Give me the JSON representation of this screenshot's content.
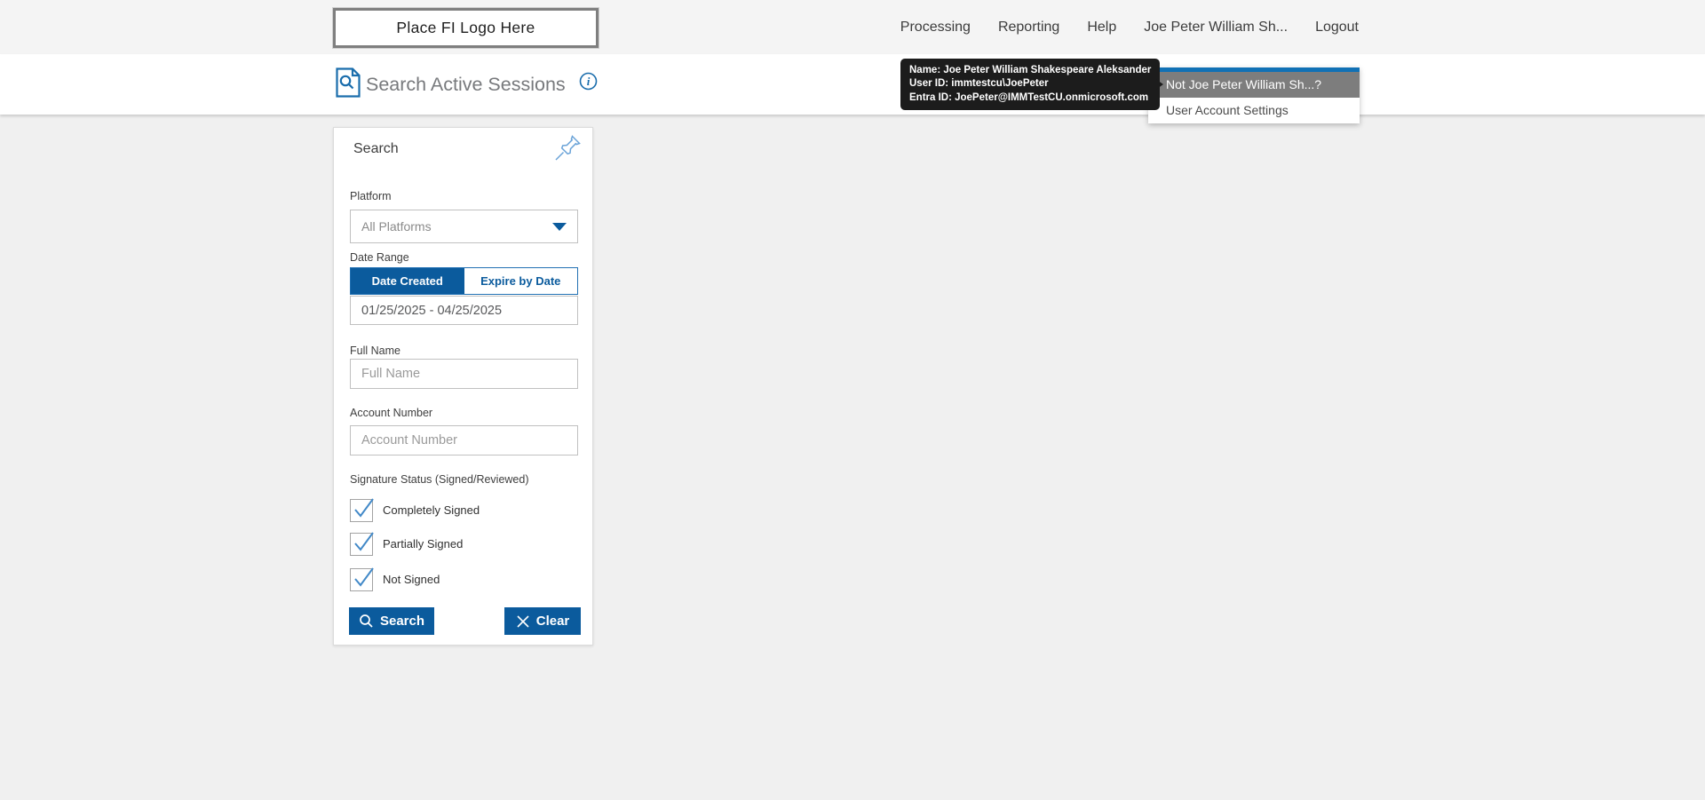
{
  "topbar": {
    "logo_text": "Place FI Logo Here",
    "nav": [
      {
        "label": "Processing"
      },
      {
        "label": "Reporting"
      },
      {
        "label": "Help"
      },
      {
        "label": "Joe Peter William Sh..."
      },
      {
        "label": "Logout"
      }
    ]
  },
  "user_tooltip": {
    "name_line": "Name: Joe Peter William Shakespeare Aleksander",
    "user_id_line": "User ID: immtestcu\\JoePeter",
    "entra_id_line": "Entra ID: JoePeter@IMMTestCU.onmicrosoft.com"
  },
  "user_menu": {
    "items": [
      {
        "label": "Not Joe Peter William Sh...?"
      },
      {
        "label": "User Account Settings"
      }
    ]
  },
  "page_header": {
    "title": "Search Active Sessions"
  },
  "search_panel": {
    "title": "Search",
    "platform": {
      "label": "Platform",
      "selected": "All Platforms"
    },
    "date_range": {
      "label": "Date Range",
      "tab_active": "Date Created",
      "tab_inactive": "Expire by Date",
      "value": "01/25/2025 - 04/25/2025"
    },
    "full_name": {
      "label": "Full Name",
      "placeholder": "Full Name",
      "value": ""
    },
    "account_number": {
      "label": "Account Number",
      "placeholder": "Account Number",
      "value": ""
    },
    "signature_status": {
      "label": "Signature Status (Signed/Reviewed)",
      "options": [
        {
          "label": "Completely Signed",
          "checked": true
        },
        {
          "label": "Partially Signed",
          "checked": true
        },
        {
          "label": "Not Signed",
          "checked": true
        }
      ]
    },
    "buttons": {
      "search": "Search",
      "clear": "Clear"
    }
  },
  "colors": {
    "accent_blue": "#0b5b9d",
    "icon_blue": "#1a6dac",
    "menu_accent_blue": "#1171b5",
    "menu_highlight_gray": "#7d7d7d",
    "check_blue": "#4289c8",
    "topbar_bg": "#f4f4f4",
    "content_bg": "#f0f0f0",
    "tooltip_bg": "#1c1c1c"
  }
}
